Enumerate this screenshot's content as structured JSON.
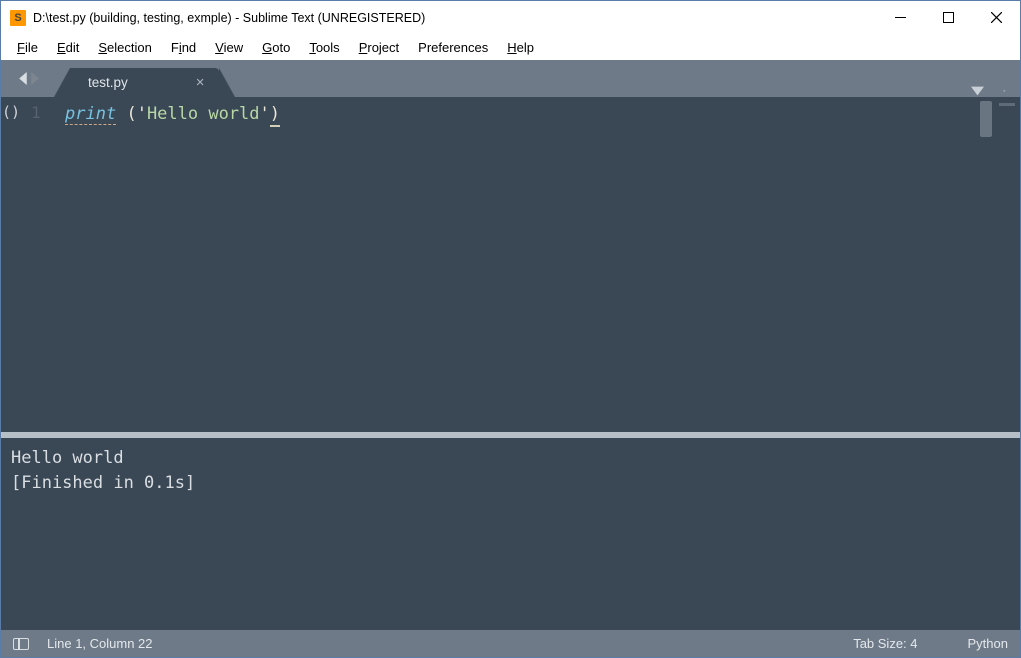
{
  "window": {
    "title": "D:\\test.py (building, testing, exmple) - Sublime Text (UNREGISTERED)"
  },
  "menu": {
    "file": "File",
    "edit": "Edit",
    "selection": "Selection",
    "find": "Find",
    "view": "View",
    "goto": "Goto",
    "tools": "Tools",
    "project": "Project",
    "preferences": "Preferences",
    "help": "Help"
  },
  "tab": {
    "name": "test.py"
  },
  "editor": {
    "fold_marker": "()",
    "line_number": "1",
    "code": {
      "fn": "print",
      "space": " ",
      "open": "(",
      "q1": "'",
      "str": "Hello world",
      "q2": "'",
      "close": ")"
    }
  },
  "output": {
    "line1": "Hello world",
    "line2": "[Finished in 0.1s]"
  },
  "statusbar": {
    "pos": "Line 1, Column 22",
    "tabsize": "Tab Size: 4",
    "lang": "Python"
  }
}
